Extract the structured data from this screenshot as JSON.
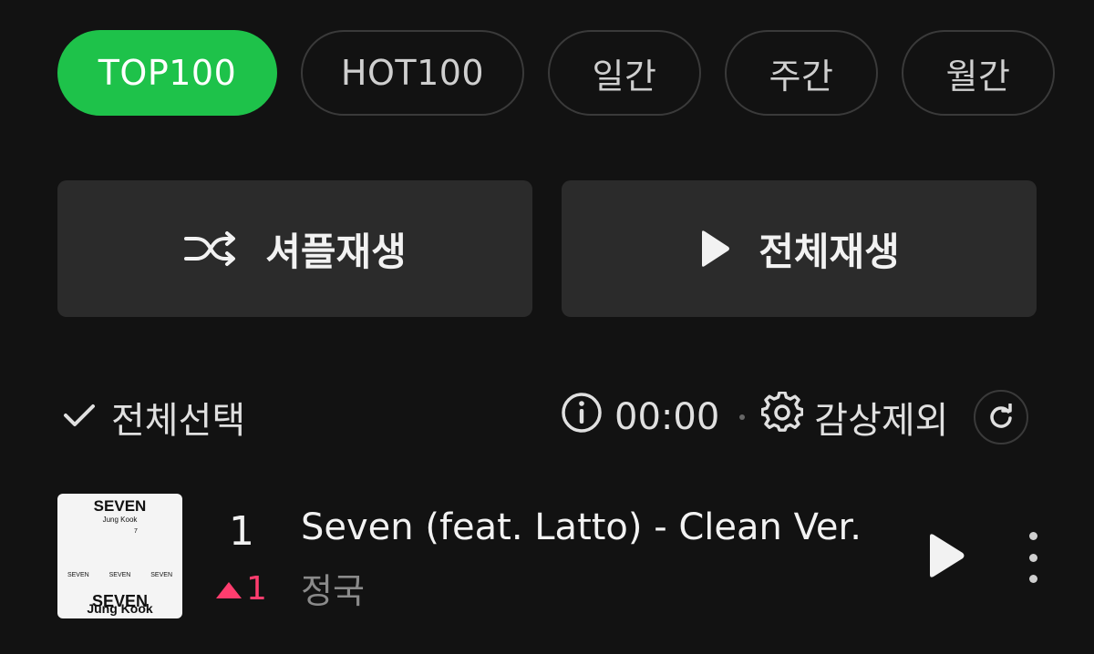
{
  "tabs": [
    {
      "label": "TOP100",
      "active": true
    },
    {
      "label": "HOT100",
      "active": false
    },
    {
      "label": "일간",
      "active": false
    },
    {
      "label": "주간",
      "active": false
    },
    {
      "label": "월간",
      "active": false
    }
  ],
  "buttons": {
    "shuffle_label": "셔플재생",
    "play_all_label": "전체재생"
  },
  "toolbar": {
    "select_all_label": "전체선택",
    "time": "00:00",
    "exclude_label": "감상제외"
  },
  "tracks": [
    {
      "rank": "1",
      "change": "1",
      "title": "Seven (feat. Latto) - Clean Ver.",
      "artist": "정국",
      "cover": {
        "title": "SEVEN",
        "subtitle": "Jung Kook",
        "mark": "7",
        "small_labels": [
          "SEVEN",
          "SEVEN",
          "SEVEN"
        ],
        "bottom_title": "SEVEN",
        "bottom_artist": "Jung Kook"
      }
    }
  ],
  "colors": {
    "background": "#121212",
    "accent": "#1ec24a",
    "rank_up": "#ff3d6e"
  },
  "icons": [
    "shuffle-icon",
    "play-icon",
    "check-icon",
    "info-icon",
    "gear-icon",
    "refresh-icon",
    "more-icon"
  ]
}
